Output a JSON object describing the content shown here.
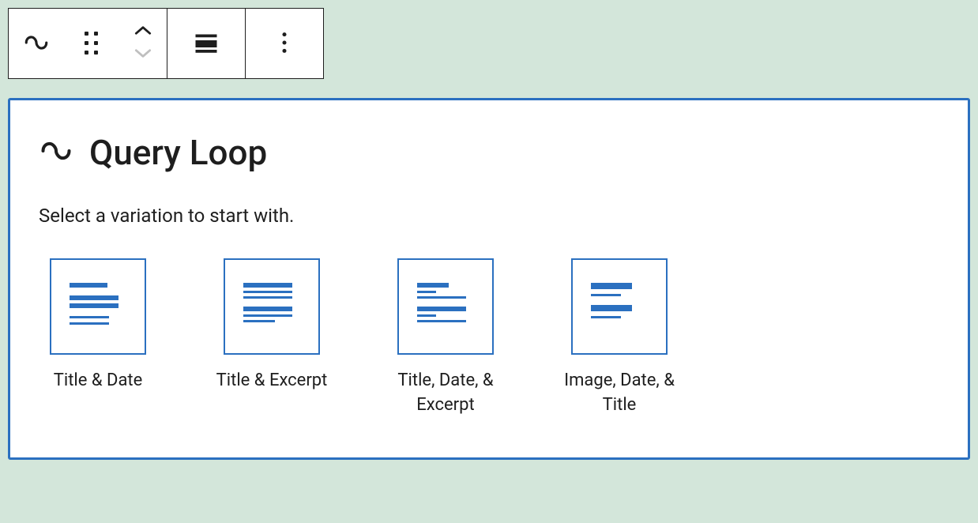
{
  "toolbar": {
    "block_type_icon": "query-loop",
    "drag_icon": "drag-handle",
    "move_up_icon": "chevron-up",
    "move_down_icon": "chevron-down",
    "align_icon": "align-full",
    "options_icon": "ellipsis-vertical"
  },
  "block": {
    "title": "Query Loop",
    "subtitle": "Select a variation to start with.",
    "icon": "query-loop"
  },
  "variations": [
    {
      "label": "Title & Date",
      "icon": "title-date"
    },
    {
      "label": "Title & Excerpt",
      "icon": "title-excerpt"
    },
    {
      "label": "Title, Date, & Excerpt",
      "icon": "title-date-excerpt"
    },
    {
      "label": "Image, Date, & Title",
      "icon": "image-date-title"
    }
  ]
}
